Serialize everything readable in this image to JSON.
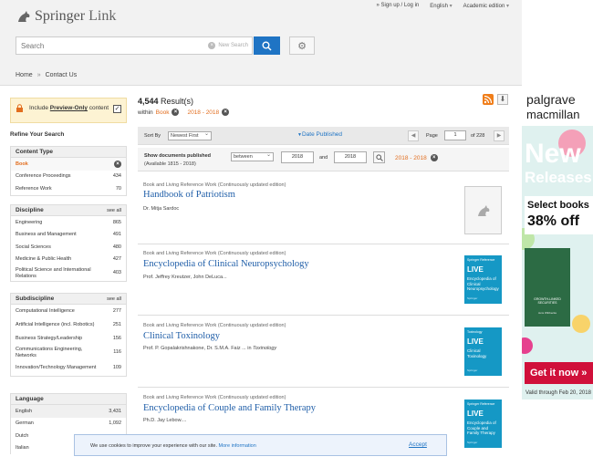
{
  "header": {
    "logo_springer": "Springer",
    "logo_link": "Link",
    "top_links": [
      "» Sign up / Log in",
      "English",
      "Academic edition"
    ],
    "search_placeholder": "Search",
    "new_search": "New Search"
  },
  "breadcrumbs": [
    "Home",
    "Contact Us"
  ],
  "preview": {
    "label_pre": "Include ",
    "label_bold": "Preview-Only",
    "label_post": " content",
    "checked": true
  },
  "refine_title": "Refine Your Search",
  "facets": {
    "content_type": {
      "title": "Content Type",
      "items": [
        {
          "label": "Book",
          "count": "",
          "selected": true
        },
        {
          "label": "Conference Proceedings",
          "count": "434"
        },
        {
          "label": "Reference Work",
          "count": "70"
        }
      ]
    },
    "discipline": {
      "title": "Discipline",
      "see_all": "see all",
      "items": [
        {
          "label": "Engineering",
          "count": "865"
        },
        {
          "label": "Business and Management",
          "count": "491"
        },
        {
          "label": "Social Sciences",
          "count": "480"
        },
        {
          "label": "Medicine & Public Health",
          "count": "427"
        },
        {
          "label": "Political Science and International Relations",
          "count": "403"
        }
      ]
    },
    "subdiscipline": {
      "title": "Subdiscipline",
      "see_all": "see all",
      "items": [
        {
          "label": "Computational Intelligence",
          "count": "277"
        },
        {
          "label": "Artificial Intelligence (incl. Robotics)",
          "count": "251"
        },
        {
          "label": "Business Strategy/Leadership",
          "count": "156"
        },
        {
          "label": "Communications Engineering, Networks",
          "count": "116"
        },
        {
          "label": "Innovation/Technology Management",
          "count": "109"
        }
      ]
    },
    "language": {
      "title": "Language",
      "items": [
        {
          "label": "English",
          "count": "3,431"
        },
        {
          "label": "German",
          "count": "1,092"
        },
        {
          "label": "Dutch",
          "count": ""
        },
        {
          "label": "Italian",
          "count": ""
        }
      ]
    }
  },
  "results": {
    "count": "4,544",
    "count_suffix": " Result(s)",
    "within_label": "within",
    "within_type": "Book",
    "within_range": "2018 - 2018"
  },
  "sortbar": {
    "sort_label": "Sort By",
    "sort_value": "Newest First",
    "date_tab": "Date Published",
    "page_label": "Page",
    "page_value": "1",
    "page_of": "of 228",
    "prev": "◀",
    "next": "▶"
  },
  "datebar": {
    "title": "Show documents published",
    "sub": "(Available 1815 - 2018)",
    "mode": "between",
    "from": "2018",
    "and": "and",
    "to": "2018",
    "applied": "2018 - 2018"
  },
  "items": [
    {
      "type": "Book and Living Reference Work (Continuously updated edition)",
      "title": "Handbook of Patriotism",
      "authors": "Dr. Mitja Sardoc",
      "in": "",
      "cover": null
    },
    {
      "type": "Book and Living Reference Work (Continuously updated edition)",
      "title": "Encyclopedia of Clinical Neuropsychology",
      "authors": "Prof. Jeffrey Kreutzer, John DeLuca...",
      "in": "",
      "cover": {
        "series": "Springer Reference",
        "live": "LIVE",
        "title": "Encyclopedia of Clinical Neuropsychology",
        "pub": "Springer"
      }
    },
    {
      "type": "Book and Living Reference Work (Continuously updated edition)",
      "title": "Clinical Toxinology",
      "authors": "Prof. P. Gopalakrishnakone, Dr. S.M.A. Faiz ... in ",
      "in": "Toxinology",
      "cover": {
        "series": "Toxinology",
        "live": "LIVE",
        "title": "Clinical Toxinology",
        "pub": "Springer"
      }
    },
    {
      "type": "Book and Living Reference Work (Continuously updated edition)",
      "title": "Encyclopedia of Couple and Family Therapy",
      "authors": "Ph.D. Jay Lebow....",
      "in": "",
      "cover": {
        "series": "Springer Reference",
        "live": "LIVE",
        "title": "Encyclopedia of Couple and Family Therapy",
        "pub": "Springer"
      }
    }
  ],
  "ad": {
    "brand1": "palgrave",
    "brand2": "macmillan",
    "headline1": "New",
    "headline2": "Releases",
    "offer1": "Select books",
    "offer2": "38% off",
    "book_title": "GROWTH-LINKED SECURITIES",
    "book_author": "Jens Wibbecke",
    "cta": "Get it now »",
    "valid": "Valid through Feb 20, 2018"
  },
  "cookie": {
    "text": "We use cookies to improve your experience with our site.",
    "link": "More information",
    "accept": "Accept"
  },
  "colors": {
    "accent": "#1f74c4",
    "orange": "#e26e1f",
    "brand_red": "#d0103a"
  }
}
